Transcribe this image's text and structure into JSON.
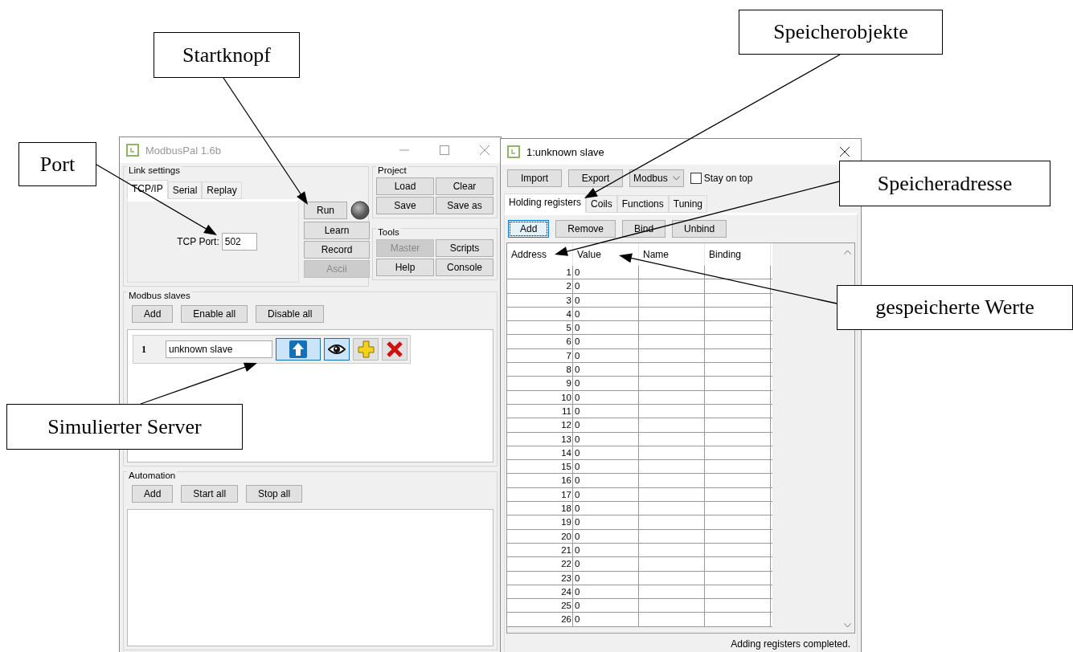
{
  "main_window": {
    "title": "ModbusPal 1.6b",
    "link_settings": {
      "title": "Link settings",
      "tabs": [
        {
          "label": "TCP/IP",
          "selected": true
        },
        {
          "label": "Serial",
          "selected": false
        },
        {
          "label": "Replay",
          "selected": false
        }
      ],
      "port_label": "TCP Port:",
      "port_value": "502"
    },
    "run_buttons": [
      {
        "label": "Run",
        "disabled": false
      },
      {
        "label": "Learn",
        "disabled": false
      },
      {
        "label": "Record",
        "disabled": false
      },
      {
        "label": "Ascii",
        "disabled": true
      }
    ],
    "project": {
      "title": "Project",
      "buttons": [
        {
          "label": "Load",
          "disabled": false
        },
        {
          "label": "Clear",
          "disabled": false
        },
        {
          "label": "Save",
          "disabled": false
        },
        {
          "label": "Save as",
          "disabled": false
        }
      ]
    },
    "tools": {
      "title": "Tools",
      "buttons": [
        {
          "label": "Master",
          "disabled": true
        },
        {
          "label": "Scripts",
          "disabled": false
        },
        {
          "label": "Help",
          "disabled": false
        },
        {
          "label": "Console",
          "disabled": false
        }
      ]
    },
    "slaves": {
      "title": "Modbus slaves",
      "buttons": [
        "Add",
        "Enable all",
        "Disable all"
      ],
      "items": [
        {
          "number": "1",
          "name": "unknown slave"
        }
      ]
    },
    "automation": {
      "title": "Automation",
      "buttons": [
        "Add",
        "Start all",
        "Stop all"
      ]
    }
  },
  "slave_window": {
    "title": "1:unknown slave",
    "buttons": [
      "Import",
      "Export"
    ],
    "protocol": "Modbus",
    "stay_on_top": {
      "label": "Stay on top",
      "checked": false
    },
    "tabs": [
      {
        "label": "Holding registers",
        "selected": true
      },
      {
        "label": "Coils",
        "selected": false
      },
      {
        "label": "Functions",
        "selected": false
      },
      {
        "label": "Tuning",
        "selected": false
      }
    ],
    "actions": [
      "Add",
      "Remove",
      "Bind",
      "Unbind"
    ],
    "columns": [
      "Address",
      "Value",
      "Name",
      "Binding"
    ],
    "rows": [
      {
        "address": "1",
        "value": "0"
      },
      {
        "address": "2",
        "value": "0"
      },
      {
        "address": "3",
        "value": "0"
      },
      {
        "address": "4",
        "value": "0"
      },
      {
        "address": "5",
        "value": "0"
      },
      {
        "address": "6",
        "value": "0"
      },
      {
        "address": "7",
        "value": "0"
      },
      {
        "address": "8",
        "value": "0"
      },
      {
        "address": "9",
        "value": "0"
      },
      {
        "address": "10",
        "value": "0"
      },
      {
        "address": "11",
        "value": "0"
      },
      {
        "address": "12",
        "value": "0"
      },
      {
        "address": "13",
        "value": "0"
      },
      {
        "address": "14",
        "value": "0"
      },
      {
        "address": "15",
        "value": "0"
      },
      {
        "address": "16",
        "value": "0"
      },
      {
        "address": "17",
        "value": "0"
      },
      {
        "address": "18",
        "value": "0"
      },
      {
        "address": "19",
        "value": "0"
      },
      {
        "address": "20",
        "value": "0"
      },
      {
        "address": "21",
        "value": "0"
      },
      {
        "address": "22",
        "value": "0"
      },
      {
        "address": "23",
        "value": "0"
      },
      {
        "address": "24",
        "value": "0"
      },
      {
        "address": "25",
        "value": "0"
      },
      {
        "address": "26",
        "value": "0"
      }
    ],
    "status": "Adding registers completed."
  },
  "annotations": [
    {
      "text": "Startknopf"
    },
    {
      "text": "Port"
    },
    {
      "text": "Speicherobjekte"
    },
    {
      "text": "Speicheradresse"
    },
    {
      "text": "gespeicherte Werte"
    },
    {
      "text": "Simulierter Server"
    }
  ]
}
